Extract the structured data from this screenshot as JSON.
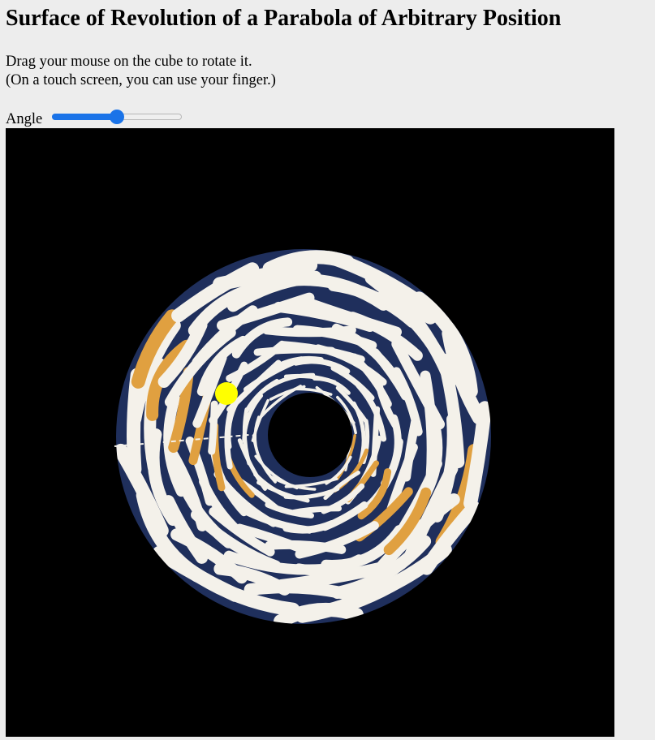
{
  "title": "Surface of Revolution of a Parabola of Arbitrary Position",
  "instructions": {
    "line1": "Drag your mouse on the cube to rotate it.",
    "line2": "(On a touch screen, you can use your finger.)"
  },
  "angle_control": {
    "label": "Angle",
    "value": 0.5
  },
  "scene": {
    "background_color": "#000000",
    "surface_colors": [
      "#1f2f5c",
      "#f4f1ea",
      "#e0a040"
    ],
    "marker_color": "#ffff00"
  },
  "colors": {
    "page_background": "#ededed",
    "slider_accent": "#1a73e8"
  }
}
